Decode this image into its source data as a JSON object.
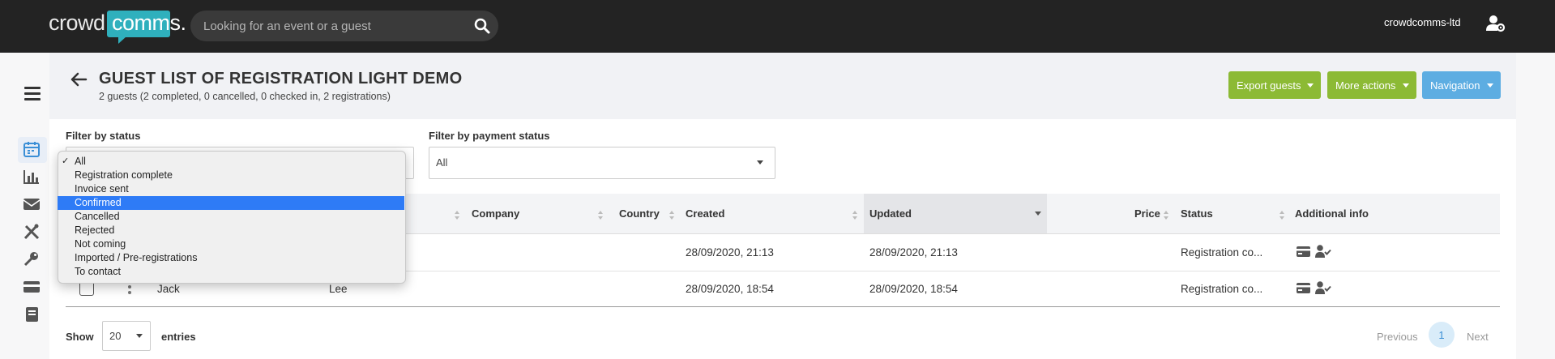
{
  "colors": {
    "topbar": "#232323",
    "brand_teal": "#2fb0bd",
    "green_button": "#8cba35",
    "blue_button": "#5dade2",
    "selected_option": "#2e7bf6"
  },
  "header": {
    "logo_left": "crowd",
    "logo_right": "comms.",
    "search_placeholder": "Looking for an event or a guest",
    "account_name": "crowdcomms-ltd"
  },
  "sidebar": {
    "icons": [
      "menu-icon",
      "calendar-icon",
      "bar-chart-icon",
      "envelope-icon",
      "tools-icon",
      "key-icon",
      "credit-card-icon",
      "book-icon"
    ]
  },
  "page": {
    "title": "GUEST LIST OF REGISTRATION LIGHT DEMO",
    "subtitle": "2 guests (2 completed, 0 cancelled, 0 checked in, 2 registrations)",
    "buttons": {
      "export": "Export guests",
      "more": "More actions",
      "navigation": "Navigation"
    }
  },
  "filters": {
    "status_label": "Filter by status",
    "payment_label": "Filter by payment status",
    "payment_value": "All",
    "status_options": [
      "All",
      "Registration complete",
      "Invoice sent",
      "Confirmed",
      "Cancelled",
      "Rejected",
      "Not coming",
      "Imported / Pre-registrations",
      "To contact"
    ],
    "status_checked": "All",
    "status_highlighted": "Confirmed"
  },
  "table": {
    "columns": [
      "Company",
      "Country",
      "Created",
      "Updated",
      "Price",
      "Status",
      "Additional info"
    ],
    "rows": [
      {
        "first_name": "",
        "last_name": "",
        "created": "28/09/2020, 21:13",
        "updated": "28/09/2020, 21:13",
        "status": "Registration co..."
      },
      {
        "first_name": "Jack",
        "last_name": "Lee",
        "created": "28/09/2020, 18:54",
        "updated": "28/09/2020, 18:54",
        "status": "Registration co..."
      }
    ]
  },
  "footer": {
    "show_label": "Show",
    "page_size": "20",
    "entries_label": "entries",
    "previous": "Previous",
    "current_page": "1",
    "next": "Next"
  }
}
